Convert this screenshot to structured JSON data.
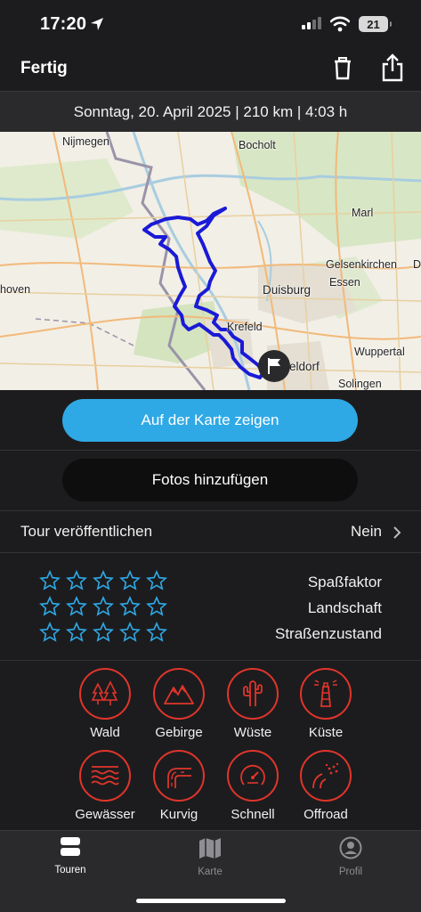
{
  "status_bar": {
    "time": "17:20",
    "battery": "21"
  },
  "nav": {
    "done_label": "Fertig"
  },
  "tour_summary": "Sonntag, 20. April 2025 | 210 km | 4:03 h",
  "map": {
    "labels": [
      "Nijmegen",
      "Bocholt",
      "Marl",
      "Gelsenkirchen",
      "D",
      "Essen",
      "hoven",
      "Duisburg",
      "Krefeld",
      "Wuppertal",
      "eldorf",
      "Solingen"
    ]
  },
  "actions": {
    "show_on_map": "Auf der Karte zeigen",
    "add_photos": "Fotos hinzufügen"
  },
  "publish": {
    "label": "Tour veröffentlichen",
    "value": "Nein"
  },
  "ratings": [
    {
      "label": "Spaßfaktor",
      "stars": 0
    },
    {
      "label": "Landschaft",
      "stars": 0
    },
    {
      "label": "Straßenzustand",
      "stars": 0
    }
  ],
  "tags": [
    {
      "label": "Wald",
      "icon": "forest-icon"
    },
    {
      "label": "Gebirge",
      "icon": "mountains-icon"
    },
    {
      "label": "Wüste",
      "icon": "cactus-icon"
    },
    {
      "label": "Küste",
      "icon": "lighthouse-icon"
    },
    {
      "label": "Gewässer",
      "icon": "water-icon"
    },
    {
      "label": "Kurvig",
      "icon": "curvy-road-icon"
    },
    {
      "label": "Schnell",
      "icon": "speedometer-icon"
    },
    {
      "label": "Offroad",
      "icon": "offroad-icon"
    }
  ],
  "tab_bar": [
    {
      "label": "Touren",
      "icon": "tours-icon",
      "active": true
    },
    {
      "label": "Karte",
      "icon": "map-icon",
      "active": false
    },
    {
      "label": "Profil",
      "icon": "profile-icon",
      "active": false
    }
  ],
  "colors": {
    "accent": "#2fa9e6",
    "tag_red": "#e0352b",
    "route": "#1a1ad6",
    "star": "#2fa9e6"
  }
}
